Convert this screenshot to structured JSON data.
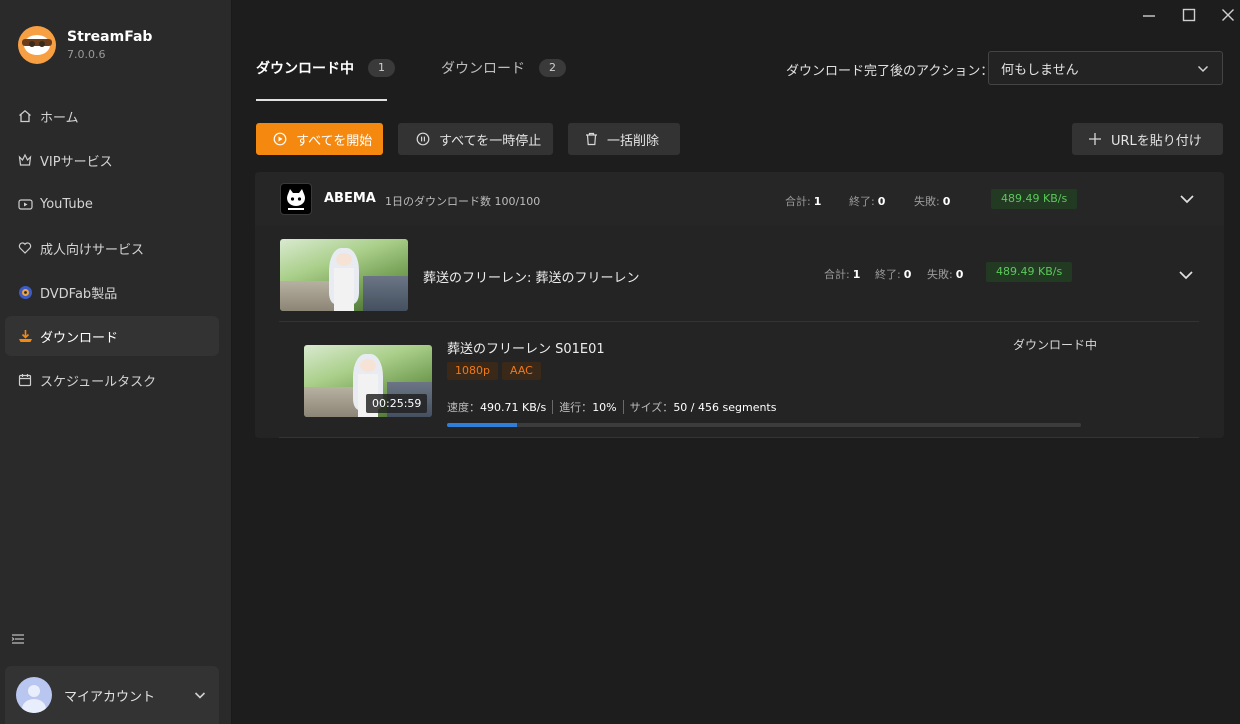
{
  "app": {
    "name": "StreamFab",
    "version": "7.0.0.6"
  },
  "sidebar": {
    "items": [
      {
        "label": "ホーム",
        "icon": "home-icon"
      },
      {
        "label": "VIPサービス",
        "icon": "crown-icon"
      },
      {
        "label": "YouTube",
        "icon": "youtube-icon"
      },
      {
        "label": "成人向けサービス",
        "icon": "heart-icon"
      },
      {
        "label": "DVDFab製品",
        "icon": "dvdfab-icon"
      },
      {
        "label": "ダウンロード",
        "icon": "download-icon",
        "active": true
      },
      {
        "label": "スケジュールタスク",
        "icon": "calendar-icon"
      }
    ],
    "account_label": "マイアカウント"
  },
  "tabs": [
    {
      "label": "ダウンロード中",
      "count": "1",
      "active": true
    },
    {
      "label": "ダウンロード",
      "count": "2"
    }
  ],
  "after_action": {
    "label": "ダウンロード完了後のアクション：",
    "value": "何もしません"
  },
  "toolbar": {
    "start_all": "すべてを開始",
    "pause_all": "すべてを一時停止",
    "delete_all": "一括削除",
    "paste_url": "URLを貼り付け"
  },
  "service": {
    "name": "ABEMA",
    "daily": "1日のダウンロード数 100/100",
    "total_label": "合計:",
    "total": "1",
    "done_label": "終了:",
    "done": "0",
    "failed_label": "失敗:",
    "failed": "0",
    "speed": "489.49 KB/s"
  },
  "series": {
    "title": "葬送のフリーレン: 葬送のフリーレン",
    "total_label": "合計:",
    "total": "1",
    "done_label": "終了:",
    "done": "0",
    "failed_label": "失敗:",
    "failed": "0",
    "speed": "489.49 KB/s"
  },
  "episode": {
    "title": "葬送のフリーレン S01E01",
    "tags": [
      "1080p",
      "AAC"
    ],
    "duration": "00:25:59",
    "status": "ダウンロード中",
    "speed_label": "速度：",
    "speed": "490.71 KB/s",
    "progress_label": "進行：",
    "progress": "10%",
    "size_label": "サイズ：",
    "size": "50 / 456 segments",
    "progress_fraction": 0.11
  },
  "colors": {
    "accent": "#f5880e",
    "speed_green": "#5cc85c",
    "progress_blue": "#2f7fd9",
    "tag_orange": "#f07a1a"
  }
}
